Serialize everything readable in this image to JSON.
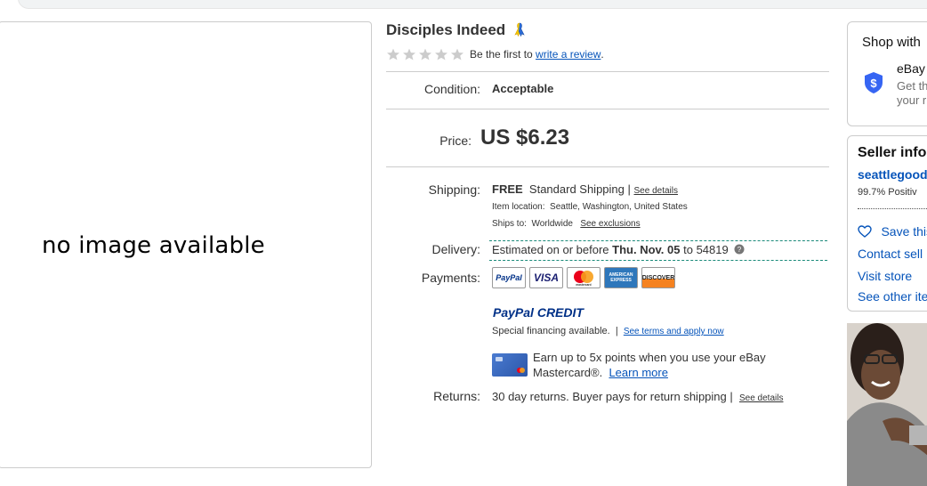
{
  "item": {
    "title": "Disciples Indeed",
    "no_image_text": "no image available"
  },
  "rating": {
    "text_prefix": "Be the first to",
    "link_text": "write a review",
    "suffix": "."
  },
  "condition": {
    "label": "Condition:",
    "value": "Acceptable"
  },
  "price": {
    "label": "Price:",
    "value": "US $6.23"
  },
  "shipping": {
    "label": "Shipping:",
    "free": "FREE",
    "method": "Standard Shipping |",
    "see_details": "See details",
    "location_label": "Item location:",
    "location": "Seattle, Washington, United States",
    "ships_to_label": "Ships to:",
    "ships_to": "Worldwide",
    "see_exclusions": "See exclusions"
  },
  "delivery": {
    "label": "Delivery:",
    "prefix": "Estimated on or before",
    "date": "Thu. Nov. 05",
    "to": "to 54819"
  },
  "payments": {
    "label": "Payments:",
    "icons": [
      "PayPal",
      "VISA",
      "mastercard",
      "AMERICAN EXPRESS",
      "DISCOVER"
    ],
    "pp_credit_a": "PayPal",
    "pp_credit_b": "CREDIT",
    "financing": "Special financing available.",
    "sep": "|",
    "terms_link": "See terms and apply now",
    "earn_text": "Earn up to 5x points when you use your eBay Mastercard®.",
    "learn_more": "Learn more"
  },
  "returns": {
    "label": "Returns:",
    "text": "30 day returns. Buyer pays for return shipping |",
    "see_details": "See details"
  },
  "side": {
    "shop_with": "Shop with",
    "ebay_label": "eBay",
    "get_text": "Get th",
    "your_text": "your r",
    "seller_info": "Seller info",
    "seller_name": "seattlegood",
    "positive": "99.7% Positiv",
    "save_seller": "Save this",
    "contact": "Contact sell",
    "visit_store": "Visit store",
    "see_other": "See other ite"
  },
  "colors": {
    "link": "#0654ba",
    "accent": "#1a8a7a",
    "shield": "#3665f3"
  }
}
